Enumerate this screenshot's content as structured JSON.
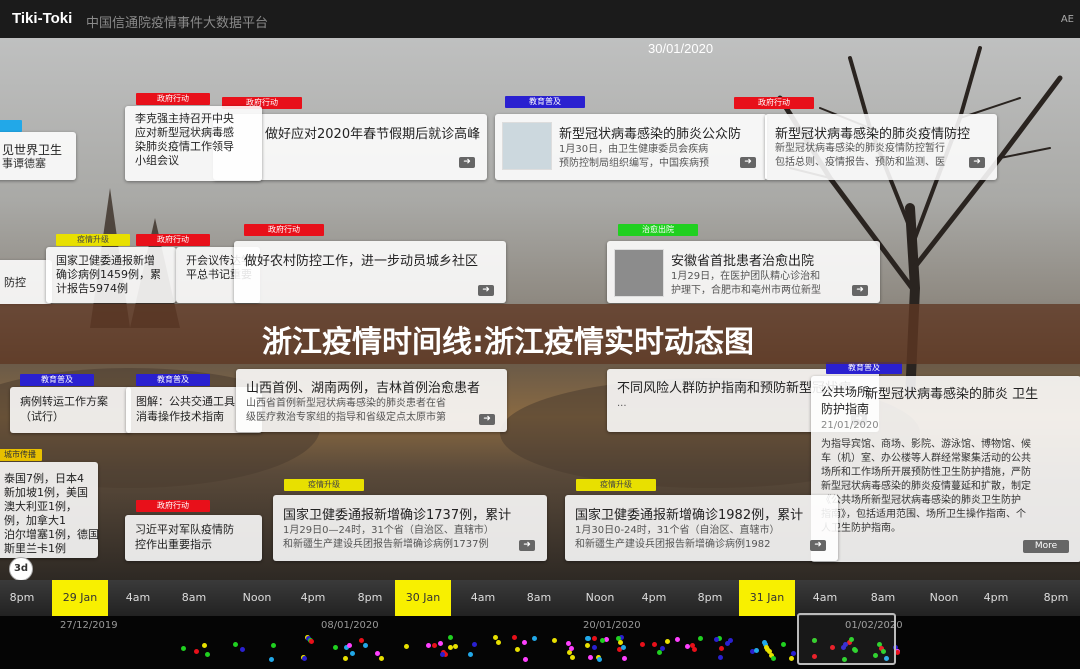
{
  "app": {
    "brand": "Tiki-Toki",
    "title": "中国信通院疫情事件大数据平台",
    "corner": "AE"
  },
  "timeline_date": "30/01/2020",
  "colors": {
    "gov": "#e8101a",
    "edu": "#2a20d0",
    "upg": "#e8e000",
    "cure": "#20d020"
  },
  "tags": {
    "gov": "政府行动",
    "edu": "教育普及",
    "upg": "疫情升级",
    "cure": "治愈出院",
    "ext": "城市传播"
  },
  "cards": {
    "c01": {
      "title": "见世界卫生",
      "d1": "事谭德塞"
    },
    "c02": {
      "l1": "李克强主持召开中央",
      "l2": "应对新型冠状病毒感",
      "l3": "染肺炎疫情工作领导",
      "l4": "小组会议"
    },
    "c03": {
      "title": "做好应对2020年春节假期后就诊高峰"
    },
    "c04": {
      "title": "新型冠状病毒感染的肺炎公众防",
      "d1": "1月30日，由卫生健康委员会疾病",
      "d2": "预防控制局组织编写，中国疾病预"
    },
    "c05": {
      "title": "新型冠状病毒感染的肺炎疫情防控",
      "d1": "新型冠状病毒感染的肺炎疫情防控暂行",
      "d2": "包括总则、疫情报告、预防和监测、医"
    },
    "c06": {
      "title": "防控"
    },
    "c07": {
      "l1": "国家卫健委通报新增",
      "l2": "确诊病例1459例，累",
      "l3": "计报告5974例"
    },
    "c08": {
      "l1": "开会议传达学",
      "l2": "平总书记重要"
    },
    "c09": {
      "title": "做好农村防控工作，进一步动员城乡社区"
    },
    "c10": {
      "title": "安徽省首批患者治愈出院",
      "d1": "1月29日，在医护团队精心诊治和",
      "d2": "护理下，合肥市和亳州市两位新型"
    },
    "c11": {
      "l1": "病例转运工作方案",
      "l2": "（试行）"
    },
    "c12": {
      "l1": "图解：公共交通工具",
      "l2": "消毒操作技术指南"
    },
    "c13": {
      "title": "山西首例、湖南两例，吉林首例治愈患者",
      "d1": "山西省首例新型冠状病毒感染的肺炎患者在省",
      "d2": "级医疗救治专家组的指导和省级定点太原市第"
    },
    "c14": {
      "title": "不同风险人群防护指南和预防新型冠状病",
      "d1": "..."
    },
    "c15": {
      "title1": "新型冠状病毒感染的肺炎 卫生",
      "title2": "公共场所",
      "title3": "防护指南",
      "d0": "21/01/2020",
      "b1": "为指导宾馆、商场、影院、游泳馆、博物馆、候",
      "b2": "车（机）室、办公楼等人群经常聚集活动的公共",
      "b3": "场所和工作场所开展预防性卫生防护措施，严防",
      "b4": "新型冠状病毒感染的肺炎疫情蔓延和扩散，制定",
      "b5": "《公共场所新型冠状病毒感染的肺炎卫生防护",
      "b6": "指南》，包括适用范围、场所卫生操作指南、个",
      "b7": "人卫生防护指南。",
      "more": "More"
    },
    "c16": {
      "l1": "泰国7例，日本4",
      "l2": "新加坡1例，美国",
      "l3": "澳大利亚1例，",
      "l4": "例，加拿大1",
      "l5": "泊尔增塞1例，德国",
      "l6": "斯里兰卡1例"
    },
    "c17": {
      "l1": "习近平对军队疫情防",
      "l2": "控作出重要指示"
    },
    "c18": {
      "title": "国家卫健委通报新增确诊1737例，累计",
      "d1": "1月29日0—24时，31个省（自治区、直辖市）",
      "d2": "和新疆生产建设兵团报告新增确诊病例1737例"
    },
    "c19": {
      "title": "国家卫健委通报新增确诊1982例，累计",
      "d1": "1月30日0-24时，31个省（自治区、直辖市）",
      "d2": "和新疆生产建设兵团报告新增确诊病例1982"
    }
  },
  "banner": "浙江疫情时间线:浙江疫情实时动态图",
  "zoom_label": "3d",
  "scale_ticks": [
    "8pm",
    "29 Jan",
    "4am",
    "8am",
    "Noon",
    "4pm",
    "8pm",
    "30 Jan",
    "4am",
    "8am",
    "Noon",
    "4pm",
    "8pm",
    "31 Jan",
    "4am",
    "8am",
    "Noon",
    "4pm",
    "8pm"
  ],
  "mini_dates": [
    "27/12/2019",
    "08/01/2020",
    "20/01/2020",
    "01/02/2020"
  ]
}
